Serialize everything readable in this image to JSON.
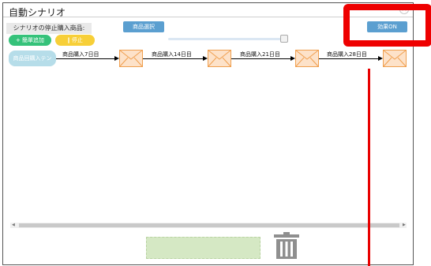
{
  "dialog": {
    "title": "自動シナリオ",
    "close_label": "×"
  },
  "toolbar": {
    "stop_product_label": "シナリオの停止購入商品:",
    "product_select_label": "商品選択",
    "effect_on_label": "効果ON",
    "add_step_label": "+ 簡單追加",
    "stop_label": "‖ 停止"
  },
  "flow": {
    "start_node_label": "商品回購入テン",
    "steps": [
      {
        "label": "商品購入7日目"
      },
      {
        "label": "商品購入14日目"
      },
      {
        "label": "商品購入21日目"
      },
      {
        "label": "商品購入28日目"
      }
    ]
  },
  "icons": {
    "mail": "envelope-icon",
    "trash": "trash-icon"
  },
  "colors": {
    "accent_blue": "#5b9fd0",
    "green": "#35c27a",
    "yellow": "#f7cf38",
    "envelope_fill": "#fde2c9",
    "envelope_stroke": "#f0a050",
    "highlight_red": "#ee0000"
  }
}
